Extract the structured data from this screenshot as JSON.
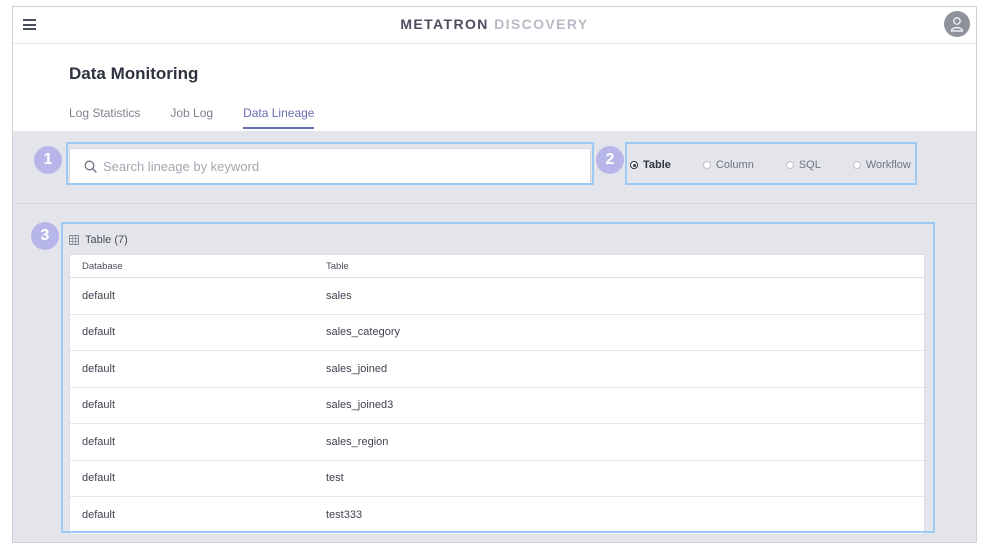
{
  "app": {
    "brand_primary": "METATRON",
    "brand_secondary": "DISCOVERY"
  },
  "header": {
    "title": "Data Monitoring",
    "tabs": [
      {
        "label": "Log Statistics",
        "active": false
      },
      {
        "label": "Job Log",
        "active": false
      },
      {
        "label": "Data Lineage",
        "active": true
      }
    ]
  },
  "search": {
    "placeholder": "Search lineage by keyword",
    "value": ""
  },
  "filter": {
    "options": [
      {
        "label": "Table",
        "checked": true
      },
      {
        "label": "Column",
        "checked": false
      },
      {
        "label": "SQL",
        "checked": false
      },
      {
        "label": "Workflow",
        "checked": false
      }
    ]
  },
  "results": {
    "title": "Table (7)",
    "columns": [
      "Database",
      "Table"
    ],
    "rows": [
      [
        "default",
        "sales"
      ],
      [
        "default",
        "sales_category"
      ],
      [
        "default",
        "sales_joined"
      ],
      [
        "default",
        "sales_joined3"
      ],
      [
        "default",
        "sales_region"
      ],
      [
        "default",
        "test"
      ],
      [
        "default",
        "test333"
      ]
    ]
  },
  "callouts": [
    "1",
    "2",
    "3"
  ],
  "colors": {
    "accent": "#666eb2",
    "callout_border": "#9ccaf4",
    "badge": "#b7b6ea",
    "band": "#e4e5ea"
  },
  "icons": {
    "menu": "hamburger-menu-icon",
    "avatar": "user-avatar-icon",
    "search": "search-icon",
    "table": "table-grid-icon"
  }
}
